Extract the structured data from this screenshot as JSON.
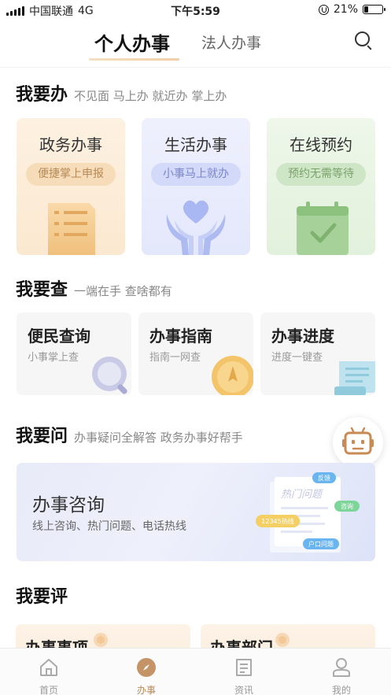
{
  "status_bar": {
    "carrier": "中国联通",
    "network": "4G",
    "time": "下午5:59",
    "battery": "21%",
    "battery_level": 0.21
  },
  "top_tabs": {
    "personal": "个人办事",
    "corporate": "法人办事"
  },
  "sections": {
    "do": {
      "title": "我要办",
      "subtitle": "不见面 马上办 就近办 掌上办"
    },
    "check": {
      "title": "我要查",
      "subtitle": "一端在手 查啥都有"
    },
    "ask": {
      "title": "我要问",
      "subtitle": "办事疑问全解答 政务办事好帮手"
    },
    "rate": {
      "title": "我要评"
    }
  },
  "do_cards": [
    {
      "title": "政务办事",
      "tag": "便捷掌上申报"
    },
    {
      "title": "生活办事",
      "tag": "小事马上就办"
    },
    {
      "title": "在线预约",
      "tag": "预约无需等待"
    }
  ],
  "check_cards": [
    {
      "title": "便民查询",
      "sub": "小事掌上查"
    },
    {
      "title": "办事指南",
      "sub": "指南一网查"
    },
    {
      "title": "办事进度",
      "sub": "进度一键查"
    }
  ],
  "consult": {
    "title": "办事咨询",
    "sub": "线上咨询、热门问题、电话热线",
    "illus": {
      "doc": "热门问题",
      "b1": "反馈",
      "b2": "咨询",
      "b3": "12345热线",
      "b4": "户口问题"
    }
  },
  "rate_cards": [
    {
      "title": "办事事项"
    },
    {
      "title": "办事部门"
    }
  ],
  "bottom_nav": [
    {
      "label": "首页",
      "icon": "home-icon"
    },
    {
      "label": "办事",
      "icon": "compass-icon"
    },
    {
      "label": "资讯",
      "icon": "news-icon"
    },
    {
      "label": "我的",
      "icon": "user-icon"
    }
  ],
  "colors": {
    "accent": "#b88a5a",
    "consult_bg": "#e8ebf8"
  }
}
